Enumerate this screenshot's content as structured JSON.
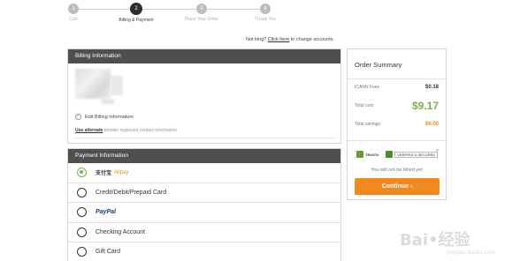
{
  "steps": [
    {
      "number": "1",
      "label": "Cart"
    },
    {
      "number": "2",
      "label": "Billing & Payment"
    },
    {
      "number": "3",
      "label": "Place Your Order"
    },
    {
      "number": "4",
      "label": "Thank You"
    }
  ],
  "account_notice": {
    "prefix": "Not king?",
    "link": "Click here",
    "suffix": "to change accounts."
  },
  "billing": {
    "title": "Billing Information",
    "edit_label": "Edit Billing Information",
    "use_alternate_link": "Use alternate",
    "use_alternate_text": "domain registrant contact information."
  },
  "payment": {
    "title": "Payment Information",
    "options": [
      {
        "label": "Alipay",
        "logo_text": "支付宝",
        "selected": true
      },
      {
        "label": "Credit/Debit/Prepaid Card",
        "selected": false
      },
      {
        "label": "PayPal",
        "selected": false
      },
      {
        "label": "Checking Account",
        "selected": false
      },
      {
        "label": "Gift Card",
        "selected": false
      }
    ]
  },
  "order_summary": {
    "title": "Order Summary",
    "icann_label": "ICANN Fees",
    "icann_value": "$0.18",
    "total_label": "Total cost",
    "total_value": "$9.17",
    "savings_label": "Total savings",
    "savings_value": "$6.00",
    "badge1": "TRUSTe",
    "badge2": "VERIFIED & SECURED",
    "not_billed": "You will not be billed yet",
    "continue_label": "Continue ›",
    "close": "×"
  },
  "watermark": {
    "main": "Bai•经验",
    "sub": "jingyan.baidu.com"
  },
  "colors": {
    "accent_green": "#7ab24a",
    "accent_orange": "#f08a1f",
    "header_gray": "#4f4f4f"
  }
}
